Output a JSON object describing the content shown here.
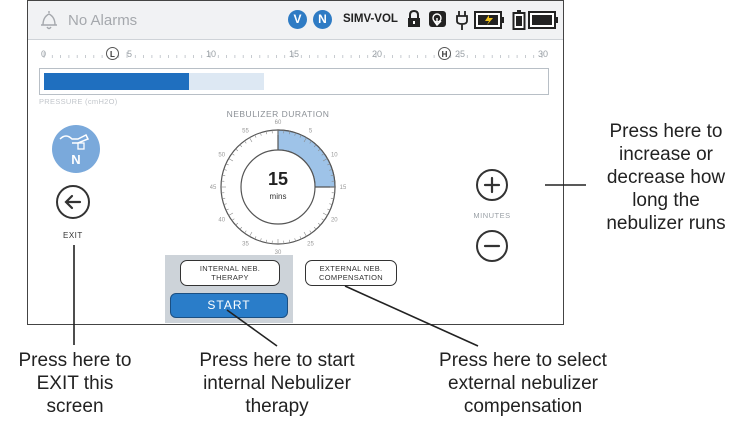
{
  "status_bar": {
    "alarm_text": "No Alarms",
    "badges": [
      "V",
      "N"
    ],
    "mode": "SIMV-VOL",
    "icons": [
      "bell-icon",
      "lock-icon",
      "touch-lock-icon",
      "power-plug-icon",
      "external-battery-charging-icon",
      "internal-battery-icon",
      "battery-full-icon"
    ]
  },
  "ruler": {
    "ticks": [
      "0",
      "5",
      "10",
      "15",
      "20",
      "25",
      "30"
    ],
    "low_marker": "L",
    "high_marker": "H"
  },
  "pressure_bar": {
    "label": "PRESSURE (cmH2O)",
    "fill_fraction": 0.29,
    "light_fraction": 0.44
  },
  "left_panel": {
    "nebulizer_badge": "N",
    "exit_label": "EXIT"
  },
  "dial": {
    "title": "NEBULIZER DURATION",
    "value": "15",
    "unit": "mins",
    "selected_minutes": 15,
    "ticks": [
      "60",
      "5",
      "10",
      "15",
      "20",
      "25",
      "30",
      "35",
      "40",
      "45",
      "50",
      "55"
    ]
  },
  "adjust": {
    "minutes_label": "MINUTES"
  },
  "buttons": {
    "internal_neb_line1": "INTERNAL NEB.",
    "internal_neb_line2": "THERAPY",
    "external_neb_line1": "EXTERNAL NEB.",
    "external_neb_line2": "COMPENSATION",
    "start": "START"
  },
  "callouts": {
    "exit": [
      "Press here to",
      "EXIT this",
      "screen"
    ],
    "start": [
      "Press here to start",
      "internal Nebulizer",
      "therapy"
    ],
    "external": [
      "Press here to select",
      "external nebulizer",
      "compensation"
    ],
    "duration": [
      "Press here to",
      "increase or",
      "decrease how",
      "long the",
      "nebulizer runs"
    ]
  },
  "colors": {
    "accent_blue": "#2a7dc9",
    "bar_fill": "#1f6fbf",
    "dial_highlight": "#9ec3e8",
    "nebulizer_icon": "#7aa9db"
  }
}
